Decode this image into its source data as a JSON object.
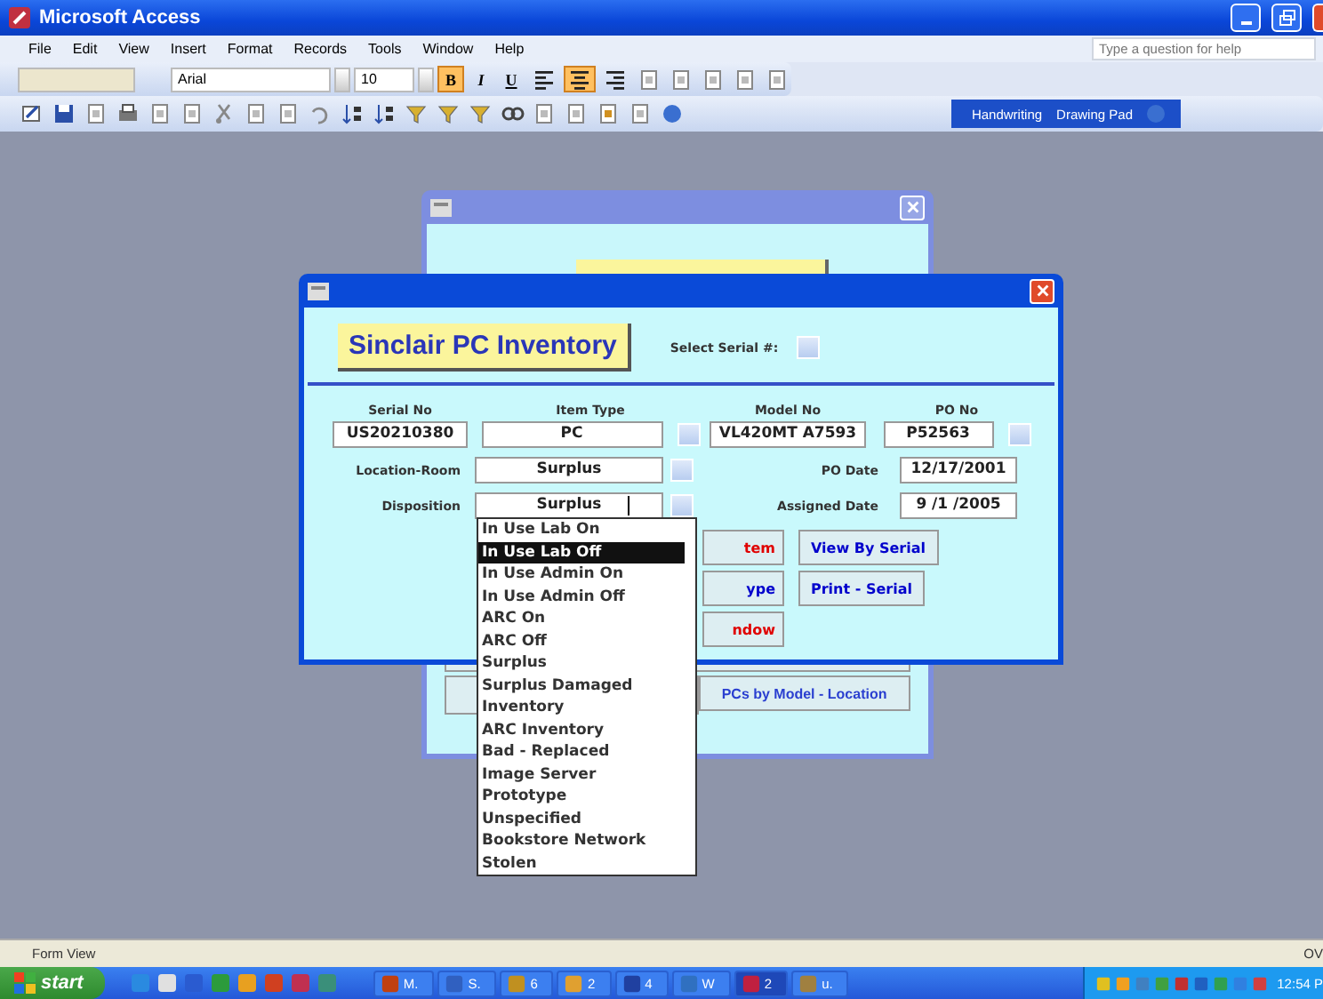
{
  "window": {
    "title": "Microsoft Access"
  },
  "menu": [
    {
      "label": "File"
    },
    {
      "label": "Edit"
    },
    {
      "label": "View"
    },
    {
      "label": "Insert"
    },
    {
      "label": "Format"
    },
    {
      "label": "Records"
    },
    {
      "label": "Tools"
    },
    {
      "label": "Window"
    },
    {
      "label": "Help"
    }
  ],
  "help_box": {
    "placeholder": "Type a question for help"
  },
  "formatting": {
    "font": "Arial",
    "size": "10",
    "styles": [
      {
        "label": "B",
        "on": true
      },
      {
        "label": "I",
        "on": false
      },
      {
        "label": "U",
        "on": false
      }
    ],
    "align": [
      {
        "kind": "left",
        "on": false
      },
      {
        "kind": "center",
        "on": true
      },
      {
        "kind": "right",
        "on": false
      }
    ]
  },
  "ink_toolbar": [
    {
      "label": "Handwriting"
    },
    {
      "label": "Drawing Pad"
    }
  ],
  "back_form": {
    "buttons": [
      {
        "label": "PCs by Model - Location"
      }
    ]
  },
  "form": {
    "title": "Sinclair PC Inventory",
    "select_label": "Select Serial #:",
    "columns": [
      {
        "label": "Serial No",
        "value": "US20210380",
        "kind": "text"
      },
      {
        "label": "Item Type",
        "value": "PC",
        "kind": "combo"
      },
      {
        "label": "Model No",
        "value": "VL420MT A7593",
        "kind": "text"
      },
      {
        "label": "PO No",
        "value": "P52563",
        "kind": "combo"
      }
    ],
    "rows": [
      {
        "label": "Location-Room",
        "value": "Surplus",
        "focused": false,
        "date_label": "PO Date",
        "date": "12/17/2001"
      },
      {
        "label": "Disposition",
        "value": "Surplus",
        "focused": true,
        "date_label": "Assigned Date",
        "date": "9 /1 /2005"
      }
    ],
    "buttons": [
      [
        {
          "label": "tem",
          "color": "#e00000"
        },
        {
          "label": "View By Serial",
          "color": "#0000cc"
        }
      ],
      [
        {
          "label": "ype",
          "color": "#0000cc"
        },
        {
          "label": "Print - Serial",
          "color": "#0000cc"
        }
      ],
      [
        {
          "label": "ndow",
          "color": "#e00000"
        }
      ]
    ]
  },
  "dropdown": {
    "items": [
      {
        "label": "In Use Lab On",
        "selected": false
      },
      {
        "label": "In Use Lab Off",
        "selected": true
      },
      {
        "label": "In Use Admin On",
        "selected": false
      },
      {
        "label": "In Use Admin Off",
        "selected": false
      },
      {
        "label": "ARC On",
        "selected": false
      },
      {
        "label": "ARC Off",
        "selected": false
      },
      {
        "label": "Surplus",
        "selected": false
      },
      {
        "label": "Surplus Damaged",
        "selected": false
      },
      {
        "label": "Inventory",
        "selected": false
      },
      {
        "label": "ARC Inventory",
        "selected": false
      },
      {
        "label": "Bad - Replaced",
        "selected": false
      },
      {
        "label": "Image Server",
        "selected": false
      },
      {
        "label": "Prototype",
        "selected": false
      },
      {
        "label": "Unspecified",
        "selected": false
      },
      {
        "label": "Bookstore Network",
        "selected": false
      },
      {
        "label": "Stolen",
        "selected": false
      }
    ]
  },
  "status_bar": {
    "text": "Form View",
    "mode": "OV"
  },
  "taskbar": {
    "start": "start",
    "tasks": [
      {
        "label": "M.",
        "active": false
      },
      {
        "label": "S.",
        "active": false
      },
      {
        "label": "6",
        "active": false
      },
      {
        "label": "2",
        "active": false
      },
      {
        "label": "4",
        "active": false
      },
      {
        "label": "W",
        "active": false
      },
      {
        "label": "2",
        "active": true
      },
      {
        "label": "u.",
        "active": false
      }
    ],
    "clock": "12:54 P"
  }
}
